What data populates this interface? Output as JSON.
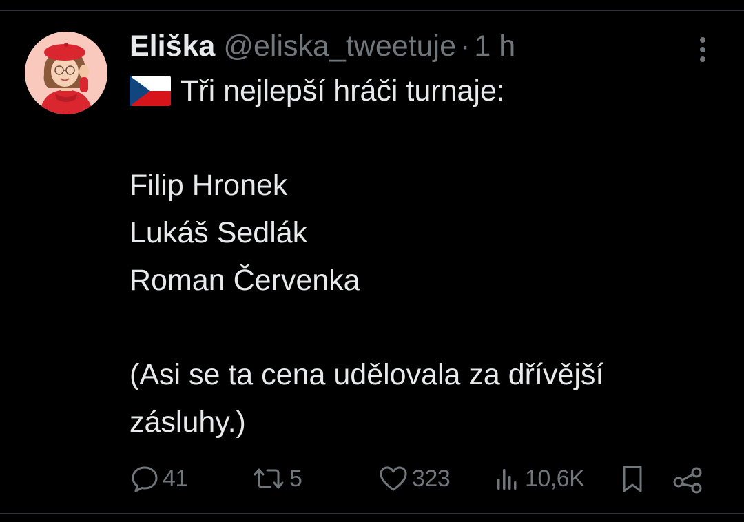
{
  "tweet": {
    "author_name": "Eliška",
    "author_handle": "@eliska_tweetuje",
    "separator": "·",
    "time": "1 h",
    "flag_icon": "czech-flag-emoji",
    "lines": [
      "Tři nejlepší hráči turnaje:",
      "Filip Hronek",
      "Lukáš Sedlák",
      "Roman Červenka",
      "(Asi se ta cena udělovala za dřívější",
      "zásluhy.)"
    ]
  },
  "actions": {
    "replies": "41",
    "retweets": "5",
    "likes": "323",
    "views": "10,6K"
  },
  "colors": {
    "background": "#000000",
    "text": "#e7e9ea",
    "secondary": "#71767b",
    "divider": "#2f3336"
  }
}
